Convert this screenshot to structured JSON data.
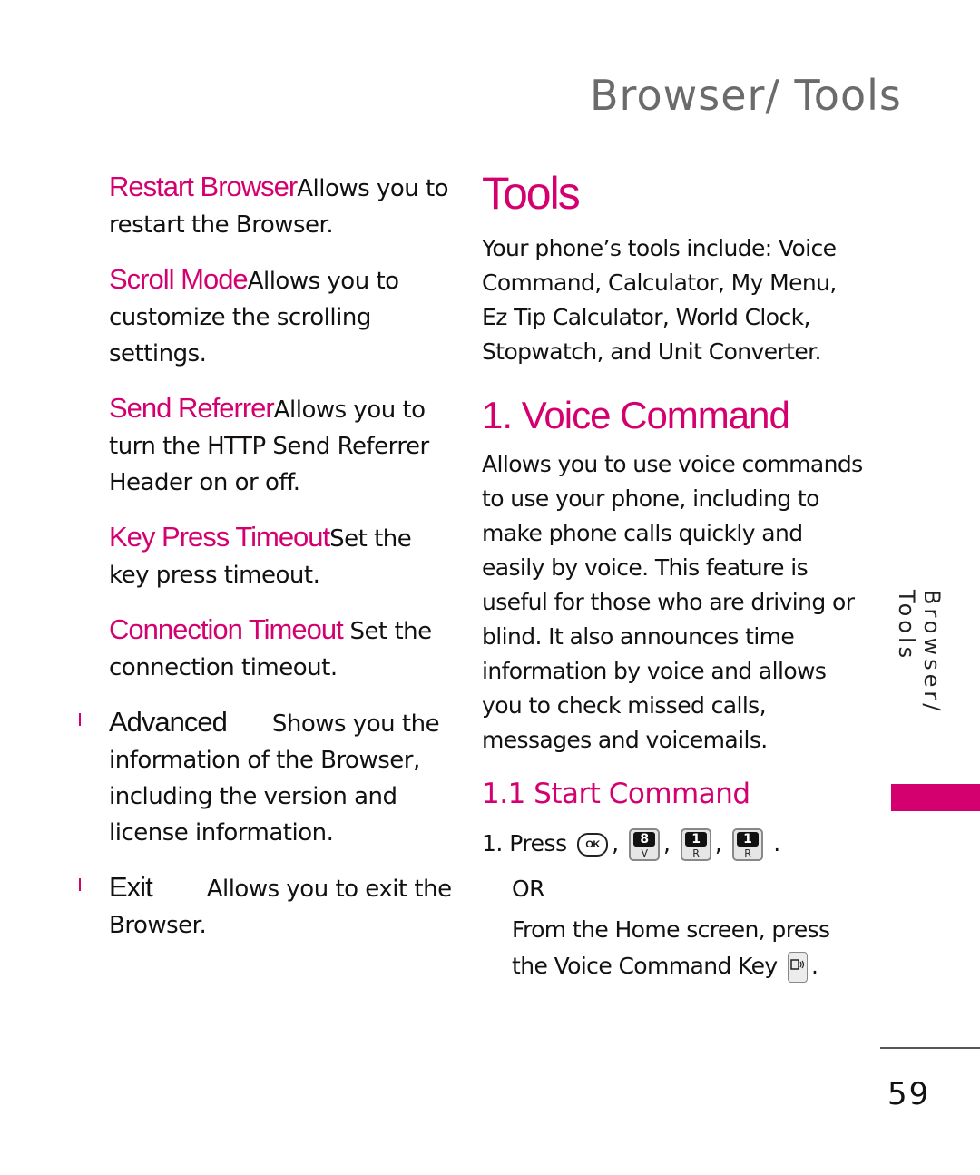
{
  "header": {
    "title": "Browser/ Tools"
  },
  "left_column": {
    "items": [
      {
        "term": "Restart Browser",
        "desc_first": "Allows you to",
        "desc_rest": "restart the Browser."
      },
      {
        "term": "Scroll Mode",
        "desc_first": "Allows you to",
        "desc_rest": "customize the scrolling settings."
      },
      {
        "term": "Send Referrer",
        "desc_first": "Allows you to",
        "desc_rest": "turn the HTTP Send Referrer Header on or off."
      },
      {
        "term": "Key Press Timeout",
        "desc_first": "Set the",
        "desc_rest": "key press timeout."
      },
      {
        "term": "Connection Timeout",
        "desc_first": "Set the",
        "desc_rest": "connection timeout."
      }
    ],
    "bullets": [
      {
        "term": "Advanced",
        "desc_first": "Shows you the",
        "desc_rest": "information of the Browser, including the version and license information."
      },
      {
        "term": "Exit",
        "desc_first": "Allows you to exit the",
        "desc_rest": "Browser."
      }
    ]
  },
  "right_column": {
    "section_title": "Tools",
    "intro": "Your phone’s tools include: Voice Command, Calculator, My Menu, Ez Tip Calculator, World Clock, Stopwatch, and Unit Converter.",
    "subsection_title": "1. Voice Command",
    "subsection_desc": "Allows you to use voice commands to use your phone, including to make phone calls quickly and easily by voice. This feature is useful for those who are driving or blind. It also announces time information by voice and allows you to check missed calls, messages and voicemails.",
    "subsubsection_title": "1.1 Start Command",
    "step1_prefix": "1. Press",
    "keys": [
      {
        "type": "ok",
        "label": "OK",
        "icon": "ok-key-icon"
      },
      {
        "type": "num",
        "digit": "8",
        "letter": "V",
        "icon": "key-8-icon"
      },
      {
        "type": "num",
        "digit": "1",
        "letter": "R",
        "icon": "key-1-icon"
      },
      {
        "type": "num",
        "digit": "1",
        "letter": "R",
        "icon": "key-1-icon"
      }
    ],
    "separator": ",",
    "end_period": ".",
    "or_text": "OR",
    "alt_line1": "From the Home screen, press",
    "alt_line2": "the Voice Command Key",
    "voice_key_glyph": "🗣",
    "voice_key_icon": "voice-command-key-icon"
  },
  "side_tab": {
    "label": "Browser/ Tools",
    "accent": "#d4006f"
  },
  "footer": {
    "page_number": "59"
  },
  "colors": {
    "accent": "#d4006f",
    "header_gray": "#6b6b6b",
    "text": "#111111"
  }
}
